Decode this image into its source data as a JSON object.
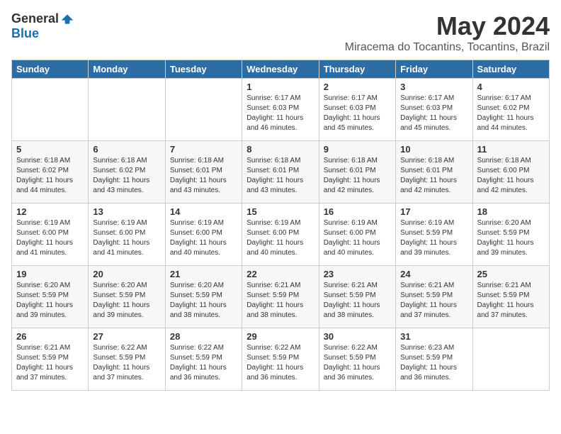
{
  "logo": {
    "general": "General",
    "blue": "Blue"
  },
  "title": "May 2024",
  "subtitle": "Miracema do Tocantins, Tocantins, Brazil",
  "days_of_week": [
    "Sunday",
    "Monday",
    "Tuesday",
    "Wednesday",
    "Thursday",
    "Friday",
    "Saturday"
  ],
  "weeks": [
    [
      {
        "day": "",
        "info": ""
      },
      {
        "day": "",
        "info": ""
      },
      {
        "day": "",
        "info": ""
      },
      {
        "day": "1",
        "info": "Sunrise: 6:17 AM\nSunset: 6:03 PM\nDaylight: 11 hours\nand 46 minutes."
      },
      {
        "day": "2",
        "info": "Sunrise: 6:17 AM\nSunset: 6:03 PM\nDaylight: 11 hours\nand 45 minutes."
      },
      {
        "day": "3",
        "info": "Sunrise: 6:17 AM\nSunset: 6:03 PM\nDaylight: 11 hours\nand 45 minutes."
      },
      {
        "day": "4",
        "info": "Sunrise: 6:17 AM\nSunset: 6:02 PM\nDaylight: 11 hours\nand 44 minutes."
      }
    ],
    [
      {
        "day": "5",
        "info": "Sunrise: 6:18 AM\nSunset: 6:02 PM\nDaylight: 11 hours\nand 44 minutes."
      },
      {
        "day": "6",
        "info": "Sunrise: 6:18 AM\nSunset: 6:02 PM\nDaylight: 11 hours\nand 43 minutes."
      },
      {
        "day": "7",
        "info": "Sunrise: 6:18 AM\nSunset: 6:01 PM\nDaylight: 11 hours\nand 43 minutes."
      },
      {
        "day": "8",
        "info": "Sunrise: 6:18 AM\nSunset: 6:01 PM\nDaylight: 11 hours\nand 43 minutes."
      },
      {
        "day": "9",
        "info": "Sunrise: 6:18 AM\nSunset: 6:01 PM\nDaylight: 11 hours\nand 42 minutes."
      },
      {
        "day": "10",
        "info": "Sunrise: 6:18 AM\nSunset: 6:01 PM\nDaylight: 11 hours\nand 42 minutes."
      },
      {
        "day": "11",
        "info": "Sunrise: 6:18 AM\nSunset: 6:00 PM\nDaylight: 11 hours\nand 42 minutes."
      }
    ],
    [
      {
        "day": "12",
        "info": "Sunrise: 6:19 AM\nSunset: 6:00 PM\nDaylight: 11 hours\nand 41 minutes."
      },
      {
        "day": "13",
        "info": "Sunrise: 6:19 AM\nSunset: 6:00 PM\nDaylight: 11 hours\nand 41 minutes."
      },
      {
        "day": "14",
        "info": "Sunrise: 6:19 AM\nSunset: 6:00 PM\nDaylight: 11 hours\nand 40 minutes."
      },
      {
        "day": "15",
        "info": "Sunrise: 6:19 AM\nSunset: 6:00 PM\nDaylight: 11 hours\nand 40 minutes."
      },
      {
        "day": "16",
        "info": "Sunrise: 6:19 AM\nSunset: 6:00 PM\nDaylight: 11 hours\nand 40 minutes."
      },
      {
        "day": "17",
        "info": "Sunrise: 6:19 AM\nSunset: 5:59 PM\nDaylight: 11 hours\nand 39 minutes."
      },
      {
        "day": "18",
        "info": "Sunrise: 6:20 AM\nSunset: 5:59 PM\nDaylight: 11 hours\nand 39 minutes."
      }
    ],
    [
      {
        "day": "19",
        "info": "Sunrise: 6:20 AM\nSunset: 5:59 PM\nDaylight: 11 hours\nand 39 minutes."
      },
      {
        "day": "20",
        "info": "Sunrise: 6:20 AM\nSunset: 5:59 PM\nDaylight: 11 hours\nand 39 minutes."
      },
      {
        "day": "21",
        "info": "Sunrise: 6:20 AM\nSunset: 5:59 PM\nDaylight: 11 hours\nand 38 minutes."
      },
      {
        "day": "22",
        "info": "Sunrise: 6:21 AM\nSunset: 5:59 PM\nDaylight: 11 hours\nand 38 minutes."
      },
      {
        "day": "23",
        "info": "Sunrise: 6:21 AM\nSunset: 5:59 PM\nDaylight: 11 hours\nand 38 minutes."
      },
      {
        "day": "24",
        "info": "Sunrise: 6:21 AM\nSunset: 5:59 PM\nDaylight: 11 hours\nand 37 minutes."
      },
      {
        "day": "25",
        "info": "Sunrise: 6:21 AM\nSunset: 5:59 PM\nDaylight: 11 hours\nand 37 minutes."
      }
    ],
    [
      {
        "day": "26",
        "info": "Sunrise: 6:21 AM\nSunset: 5:59 PM\nDaylight: 11 hours\nand 37 minutes."
      },
      {
        "day": "27",
        "info": "Sunrise: 6:22 AM\nSunset: 5:59 PM\nDaylight: 11 hours\nand 37 minutes."
      },
      {
        "day": "28",
        "info": "Sunrise: 6:22 AM\nSunset: 5:59 PM\nDaylight: 11 hours\nand 36 minutes."
      },
      {
        "day": "29",
        "info": "Sunrise: 6:22 AM\nSunset: 5:59 PM\nDaylight: 11 hours\nand 36 minutes."
      },
      {
        "day": "30",
        "info": "Sunrise: 6:22 AM\nSunset: 5:59 PM\nDaylight: 11 hours\nand 36 minutes."
      },
      {
        "day": "31",
        "info": "Sunrise: 6:23 AM\nSunset: 5:59 PM\nDaylight: 11 hours\nand 36 minutes."
      },
      {
        "day": "",
        "info": ""
      }
    ]
  ]
}
